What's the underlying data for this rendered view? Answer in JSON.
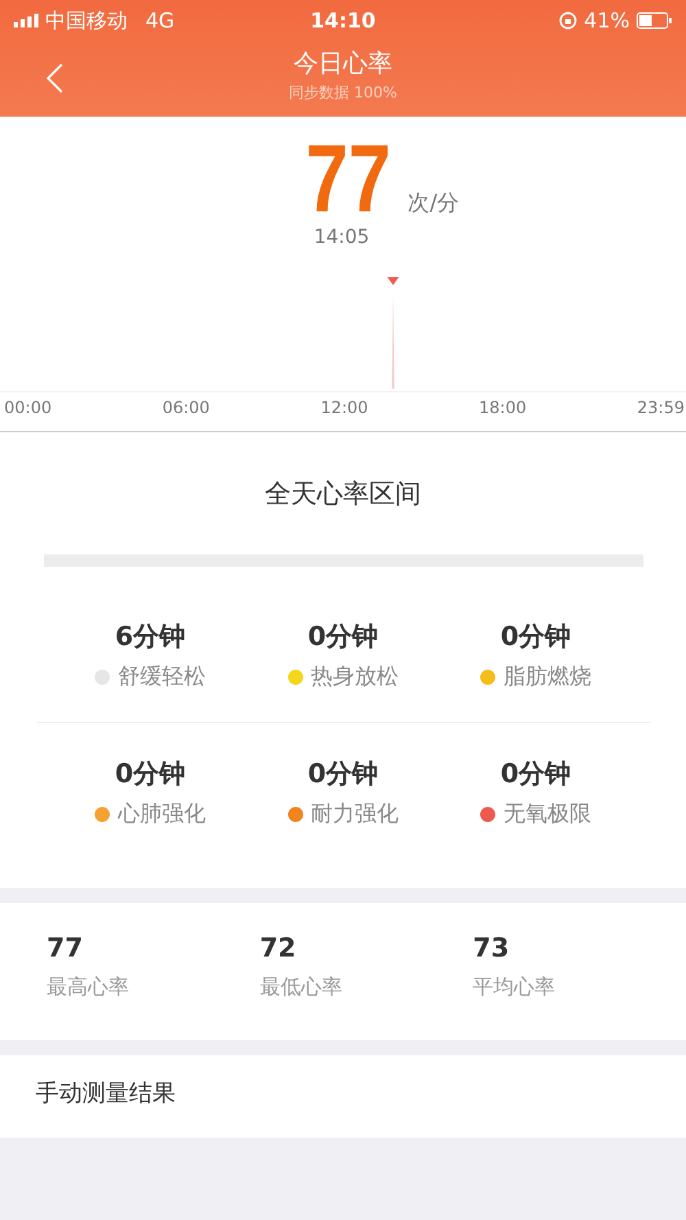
{
  "status_bar": {
    "carrier": "中国移动",
    "network": "4G",
    "time": "14:10",
    "battery": "41%"
  },
  "header": {
    "title": "今日心率",
    "subtitle": "同步数据 100%"
  },
  "current": {
    "value": "77",
    "unit": "次/分",
    "time": "14:05"
  },
  "chart": {
    "x_labels": [
      "00:00",
      "06:00",
      "12:00",
      "18:00",
      "23:59"
    ]
  },
  "zones": {
    "title": "全天心率区间",
    "items": [
      {
        "duration": "6分钟",
        "label": "舒缓轻松",
        "color": "#e6e6e6"
      },
      {
        "duration": "0分钟",
        "label": "热身放松",
        "color": "#f5d61c"
      },
      {
        "duration": "0分钟",
        "label": "脂肪燃烧",
        "color": "#f4bd1a"
      },
      {
        "duration": "0分钟",
        "label": "心肺强化",
        "color": "#f5a233"
      },
      {
        "duration": "0分钟",
        "label": "耐力强化",
        "color": "#f2831f"
      },
      {
        "duration": "0分钟",
        "label": "无氧极限",
        "color": "#ee5a4f"
      }
    ]
  },
  "stats": [
    {
      "value": "77",
      "label": "最高心率"
    },
    {
      "value": "72",
      "label": "最低心率"
    },
    {
      "value": "73",
      "label": "平均心率"
    }
  ],
  "manual": {
    "title": "手动测量结果"
  }
}
